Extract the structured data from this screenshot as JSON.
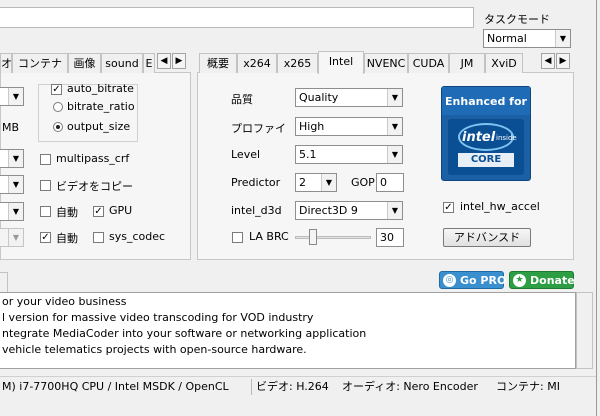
{
  "task_mode": {
    "label": "タスクモード",
    "value": "Normal"
  },
  "left_tabs": [
    "オ",
    "コンテナ",
    "画像",
    "sound",
    "E"
  ],
  "right_tabs": [
    "概要",
    "x264",
    "x265",
    "Intel",
    "NVENC",
    "CUDA",
    "JM",
    "XviD"
  ],
  "left_panel": {
    "unit_label": "MB",
    "auto_bitrate": {
      "label": "auto_bitrate",
      "checked": true
    },
    "bitrate_ratio": {
      "label": "bitrate_ratio"
    },
    "output_size": {
      "label": "output_size"
    },
    "multipass_crf": "multipass_crf",
    "video_copy": "ビデオをコピー",
    "auto1": "自動",
    "gpu": "GPU",
    "auto2": "自動",
    "sys_codec": "sys_codec"
  },
  "intel_panel": {
    "quality_label": "品質",
    "quality_value": "Quality",
    "profile_label": "プロファイ",
    "profile_value": "High",
    "level_label": "Level",
    "level_value": "5.1",
    "predictor_label": "Predictor",
    "predictor_value": "2",
    "gop_label": "GOP",
    "gop_value": "0",
    "d3d_label": "intel_d3d",
    "d3d_value": "Direct3D 9",
    "labrc_label": "LA BRC",
    "labrc_value": "30",
    "hw_accel_label": "intel_hw_accel",
    "advanced_label": "アドバンスド"
  },
  "badge": {
    "line1": "Enhanced for",
    "brand": "intel",
    "sub": "inside",
    "core": "CORE"
  },
  "buttons": {
    "go_pro": "Go PRO",
    "donate": "Donate"
  },
  "log_lines": [
    "or your video business",
    "l version for massive video transcoding for VOD industry",
    "ntegrate MediaCoder into your software or networking application",
    "vehicle telematics projects with open-source hardware."
  ],
  "status": {
    "cpu": "M) i7-7700HQ CPU  / Intel MSDK / OpenCL",
    "video": "ビデオ: H.264",
    "audio": "オーディオ: Nero Encoder",
    "container": "コンテナ: MI"
  },
  "colors": {
    "badge_blue": "#1b5fa4",
    "go_pro": "#3a8fcf",
    "donate": "#2e9e45"
  }
}
